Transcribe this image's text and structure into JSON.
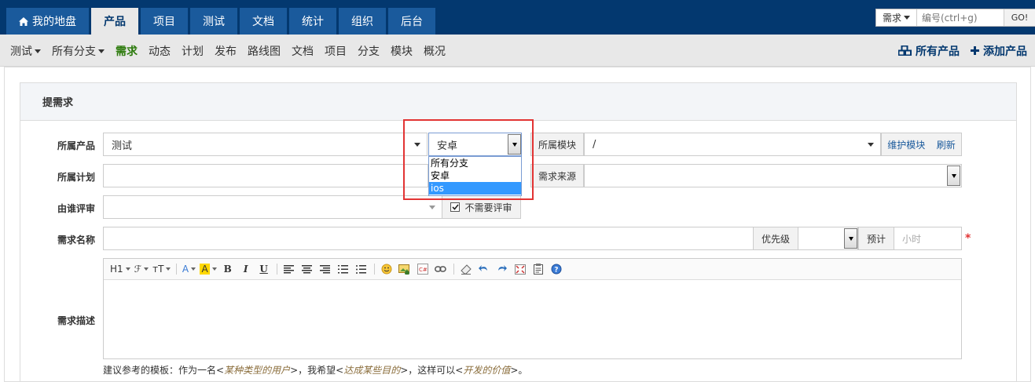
{
  "topnav": {
    "tabs": [
      {
        "label": "我的地盘",
        "icon": "home-icon"
      },
      {
        "label": "产品",
        "active": true
      },
      {
        "label": "项目"
      },
      {
        "label": "测试"
      },
      {
        "label": "文档"
      },
      {
        "label": "统计"
      },
      {
        "label": "组织"
      },
      {
        "label": "后台"
      }
    ],
    "search": {
      "type": "需求",
      "placeholder": "编号(ctrl+g)",
      "go": "GO!"
    }
  },
  "subnav": {
    "product_switch": "测试",
    "branch_switch": "所有分支",
    "links": [
      "需求",
      "动态",
      "计划",
      "发布",
      "路线图",
      "文档",
      "项目",
      "分支",
      "模块",
      "概况"
    ],
    "active_link": "需求",
    "right": {
      "all_products": "所有产品",
      "add_product": "添加产品"
    }
  },
  "form": {
    "title": "提需求",
    "product_label": "所属产品",
    "product_value": "测试",
    "branch_value": "安卓",
    "branch_options": [
      "所有分支",
      "安卓",
      "ios"
    ],
    "branch_highlighted": "ios",
    "module_label": "所属模块",
    "module_value": "/",
    "maintain_module": "维护模块",
    "refresh": "刷新",
    "plan_label": "所属计划",
    "source_label": "需求来源",
    "reviewer_label": "由谁评审",
    "no_review": "不需要评审",
    "name_label": "需求名称",
    "priority_label": "优先级",
    "estimate_label": "预计",
    "estimate_placeholder": "小时",
    "required_mark": "*",
    "desc_label": "需求描述",
    "hint_prefix": "建议参考的模板：作为一名<",
    "hint_user": "某种类型的用户",
    "hint_mid1": ">，我希望<",
    "hint_goal": "达成某些目的",
    "hint_mid2": ">，这样可以<",
    "hint_value": "开发的价值",
    "hint_suffix": ">。"
  },
  "toolbar": {
    "heading": "H1",
    "font": "ℱ",
    "fontsize": "тT",
    "forecolor": "A",
    "hilite": "A",
    "bold": "B",
    "italic": "I",
    "underline": "U"
  },
  "colors": {
    "nav": "#03386f",
    "tab": "#1a5a9c",
    "active_link": "#2b7a0b",
    "highlight": "#3399ff",
    "callout": "#e23434"
  }
}
